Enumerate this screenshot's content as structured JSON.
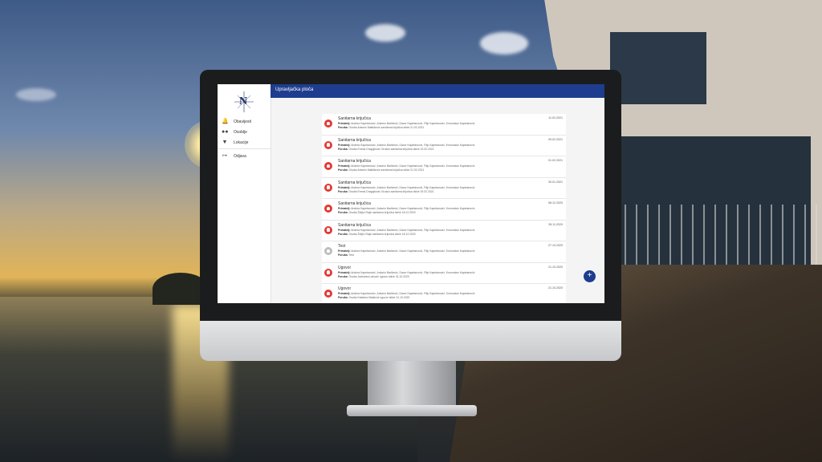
{
  "app": {
    "title": "Upravljačka ploča",
    "logo_letter": "N"
  },
  "sidebar": {
    "items": [
      {
        "label": "Obavijesti",
        "icon": "bell-icon"
      },
      {
        "label": "Osoblje",
        "icon": "people-icon"
      },
      {
        "label": "Lokacije",
        "icon": "location-pin-icon"
      },
      {
        "label": "Odjava",
        "icon": "logout-icon"
      }
    ]
  },
  "notifications": [
    {
      "title": "Sanitarna krijučica",
      "recipients_label": "Primatelj:",
      "recipients": "Andrea Kapetanović, Antonio Barišević, Davor Kapetanović, Filip Kapetanović, Kromoslav Kapetanović",
      "message_label": "Poruka:",
      "message": "Osoba Antonio Matišković sanitarna krijučica istiće 21.02.2021",
      "date": "11.02.2021",
      "status": "alert"
    },
    {
      "title": "Sanitarna krijučica",
      "recipients_label": "Primatelj:",
      "recipients": "Andrea Kapetanović, Antonio Barišević, Davor Kapetanović, Filip Kapetanović, Kromoslav Kapetanović",
      "message_label": "Poruka:",
      "message": "Osoba Emma Dragojković Grusko sanitarna krijučica istiće 19.02.2021",
      "date": "09.02.2021",
      "status": "alert"
    },
    {
      "title": "Sanitarna krijučica",
      "recipients_label": "Primatelj:",
      "recipients": "Andrea Kapetanović, Antonio Barišević, Davor Kapetanović, Filip Kapetanović, Kromoslav Kapetanović",
      "message_label": "Poruka:",
      "message": "Osoba Antonio Matišković sanitarna krijučica istiće 21.02.2021",
      "date": "01.02.2021",
      "status": "alert"
    },
    {
      "title": "Sanitarna krijučica",
      "recipients_label": "Primatelj:",
      "recipients": "Andrea Kapetanović, Antonio Barišević, Davor Kapetanović, Filip Kapetanović, Kromoslav Kapetanović",
      "message_label": "Poruka:",
      "message": "Osoba Emma Dragojković Grusko sanitarna krijučica istiće 19.02.2021",
      "date": "30.01.2021",
      "status": "alert"
    },
    {
      "title": "Sanitarna krijučica",
      "recipients_label": "Primatelj:",
      "recipients": "Andrea Kapetanović, Antonio Barišević, Davor Kapetanović, Filip Kapetanović, Kromoslav Kapetanović",
      "message_label": "Poruka:",
      "message": "Osoba Željko Rajić sanitarna krijučica istiće 18.12.2020",
      "date": "08.12.2020",
      "status": "alert"
    },
    {
      "title": "Sanitarna krijučica",
      "recipients_label": "Primatelj:",
      "recipients": "Andrea Kapetanović, Antonio Barišević, Davor Kapetanović, Filip Kapetanović, Kromoslav Kapetanović",
      "message_label": "Poruka:",
      "message": "Osoba Željko Rajić sanitarna krijučica istiće 18.12.2020",
      "date": "28.11.2020",
      "status": "alert"
    },
    {
      "title": "Test",
      "recipients_label": "Primatelj:",
      "recipients": "Andrea Kapetanović, Antonio Barišević, Davor Kapetanović, Filip Kapetanović, Kromoslav Kapetanović",
      "message_label": "Poruka:",
      "message": "Test",
      "date": "27.10.2020",
      "status": "muted"
    },
    {
      "title": "Ugovor",
      "recipients_label": "Primatelj:",
      "recipients": "Andrea Kapetanović, Antonio Barišević, Davor Kapetanović, Filip Kapetanović, Kromoslav Kapetanović",
      "message_label": "Poruka:",
      "message": "Osoba Jadranka Laković ugovor istiće 31.10.2020",
      "date": "21.10.2020",
      "status": "alert"
    },
    {
      "title": "Ugovor",
      "recipients_label": "Primatelj:",
      "recipients": "Andrea Kapetanović, Antonio Barišević, Davor Kapetanović, Filip Kapetanović, Kromoslav Kapetanović",
      "message_label": "Poruka:",
      "message": "Osoba Katarina Matković ugovor istiće 31.10.2020",
      "date": "21.10.2020",
      "status": "alert"
    }
  ],
  "fab": {
    "label": "+"
  },
  "colors": {
    "primary": "#1e3d8f",
    "alert": "#e53935",
    "muted": "#bdbdbd"
  }
}
